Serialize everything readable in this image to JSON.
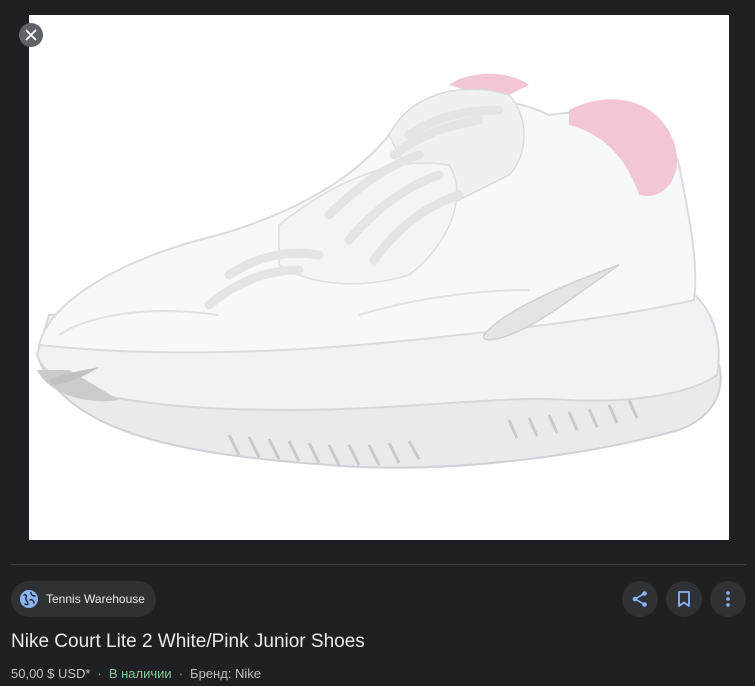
{
  "viewer": {
    "close_icon": "close-icon",
    "image_alt": "Nike Court Lite 2 White/Pink Junior Shoes"
  },
  "source": {
    "icon": "globe-icon",
    "name": "Tennis Warehouse"
  },
  "actions": [
    {
      "name": "share",
      "icon": "share-icon"
    },
    {
      "name": "save",
      "icon": "bookmark-icon"
    },
    {
      "name": "more",
      "icon": "more-vert-icon"
    }
  ],
  "product": {
    "title": "Nike Court Lite 2 White/Pink Junior Shoes",
    "price": "50,00 $ USD*",
    "separator": "·",
    "availability": "В наличии",
    "brand": "Бренд: Nike"
  },
  "colors": {
    "background": "#1f2023",
    "chip": "#303134",
    "accent": "#8ab4f8",
    "in_stock": "#81c995"
  }
}
